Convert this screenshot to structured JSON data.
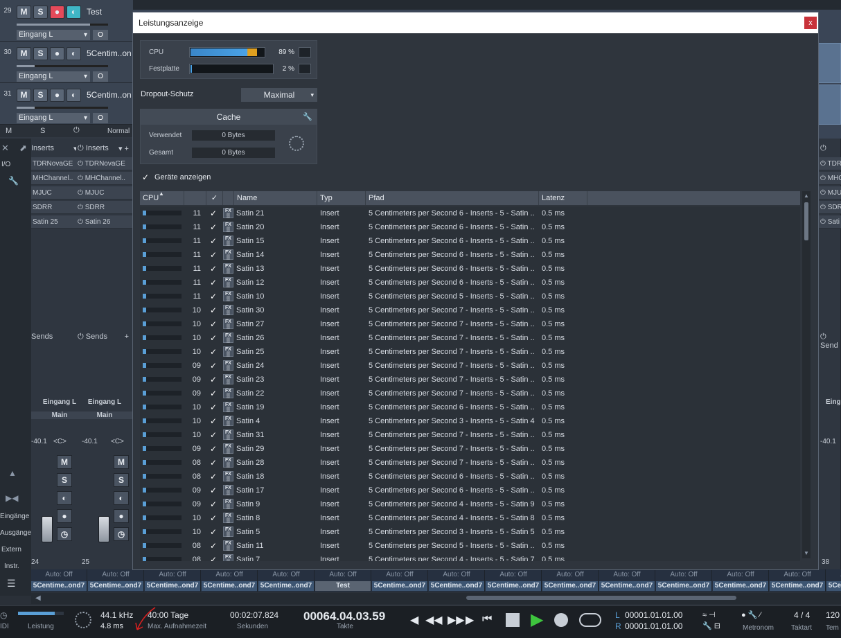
{
  "tracks": [
    {
      "num": "29",
      "m": "M",
      "s": "S",
      "name": "Test",
      "input": "Eingang L",
      "rec_active": true
    },
    {
      "num": "30",
      "m": "M",
      "s": "S",
      "name": "5Centim..on",
      "input": "Eingang L",
      "rec_active": false
    },
    {
      "num": "31",
      "m": "M",
      "s": "S",
      "name": "5Centim..on",
      "input": "Eingang L",
      "rec_active": false
    }
  ],
  "track_footer": {
    "m": "M",
    "s": "S",
    "mode": "Normal"
  },
  "mixer": {
    "left_labels": [
      "I/O",
      "Eingänge",
      "Ausgänge",
      "Extern",
      "Instr."
    ],
    "inserts_label": "Inserts",
    "sends_label": "Sends",
    "ch1_inserts": [
      "TDRNovaGE",
      "MHChannel..",
      "MJUC",
      "SDRR",
      "Satin 25"
    ],
    "ch2_inserts": [
      "TDRNovaGE",
      "MHChannel..",
      "MJUC",
      "SDRR",
      "Satin 26"
    ],
    "input_label": "Eingang L",
    "output_label": "Main",
    "ch1_vol": "-40.1",
    "ch2_vol": "-40.1",
    "ch_pan": "<C>",
    "ch1_num": "24",
    "ch2_num": "25",
    "right_num": "38",
    "right_vol": "-40.1",
    "right_insert_partial": [
      "TDR",
      "MHC",
      "MJU",
      "SDR",
      "Sati"
    ],
    "right_sends": "Send",
    "right_input": "Eing",
    "scale": [
      "10",
      "6",
      "0",
      "-6",
      "-12",
      "-24",
      "-36",
      "-48",
      "-72"
    ]
  },
  "channel_strip": [
    {
      "auto": "Auto: Off",
      "name": "5Centime..ond7"
    },
    {
      "auto": "Auto: Off",
      "name": "5Centime..ond7"
    },
    {
      "auto": "Auto: Off",
      "name": "5Centime..ond7"
    },
    {
      "auto": "Auto: Off",
      "name": "5Centime..ond7"
    },
    {
      "auto": "Auto: Off",
      "name": "5Centime..ond7"
    },
    {
      "auto": "Auto: Off",
      "name": "Test"
    },
    {
      "auto": "Auto: Off",
      "name": "5Centime..ond7"
    },
    {
      "auto": "Auto: Off",
      "name": "5Centime..ond7"
    },
    {
      "auto": "Auto: Off",
      "name": "5Centime..ond7"
    },
    {
      "auto": "Auto: Off",
      "name": "5Centime..ond7"
    },
    {
      "auto": "Auto: Off",
      "name": "5Centime..ond7"
    },
    {
      "auto": "Auto: Off",
      "name": "5Centime..ond7"
    },
    {
      "auto": "Auto: Off",
      "name": "5Centime..ond7"
    },
    {
      "auto": "Auto: Off",
      "name": "5Centime..ond7"
    },
    {
      "auto": "Auto: Off",
      "name": "5Centime..ond7"
    }
  ],
  "transport": {
    "midi": "IDI",
    "performance_label": "Leistung",
    "sample_rate": "44.1 kHz",
    "latency": "4.8 ms",
    "rec_time": "40:00 Tage",
    "rec_time_label": "Max. Aufnahmezeit",
    "seconds": "00:02:07.824",
    "seconds_label": "Sekunden",
    "bars": "00064.04.03.59",
    "bars_label": "Takte",
    "loop_l": "00001.01.01.00",
    "loop_r": "00001.01.01.00",
    "l": "L",
    "r": "R",
    "metronome": "Metronom",
    "timesig": "4 / 4",
    "timesig_label": "Taktart",
    "tempo": "120",
    "tempo_label": "Tem"
  },
  "dialog": {
    "title": "Leistungsanzeige",
    "close": "x",
    "cpu_label": "CPU",
    "cpu_value": "89 %",
    "cpu_level": 0.89,
    "disk_label": "Festplatte",
    "disk_value": "2 %",
    "disk_level": 0.02,
    "dropout_label": "Dropout-Schutz",
    "dropout_value": "Maximal",
    "cache_title": "Cache",
    "cache_used_label": "Verwendet",
    "cache_used_value": "0 Bytes",
    "cache_total_label": "Gesamt",
    "cache_total_value": "0 Bytes",
    "show_devices_label": "Geräte anzeigen",
    "columns": {
      "cpu": "CPU",
      "name": "Name",
      "type": "Typ",
      "path": "Pfad",
      "latency": "Latenz"
    },
    "rows": [
      {
        "n": "11",
        "name": "Satin 21",
        "type": "Insert",
        "path": "5 Centimeters per Second 6 - Inserts - 5 - Satin ..",
        "lat": "0.5 ms"
      },
      {
        "n": "11",
        "name": "Satin 20",
        "type": "Insert",
        "path": "5 Centimeters per Second 6 - Inserts - 5 - Satin ..",
        "lat": "0.5 ms"
      },
      {
        "n": "11",
        "name": "Satin 15",
        "type": "Insert",
        "path": "5 Centimeters per Second 6 - Inserts - 5 - Satin ..",
        "lat": "0.5 ms"
      },
      {
        "n": "11",
        "name": "Satin 14",
        "type": "Insert",
        "path": "5 Centimeters per Second 6 - Inserts - 5 - Satin ..",
        "lat": "0.5 ms"
      },
      {
        "n": "11",
        "name": "Satin 13",
        "type": "Insert",
        "path": "5 Centimeters per Second 6 - Inserts - 5 - Satin ..",
        "lat": "0.5 ms"
      },
      {
        "n": "11",
        "name": "Satin 12",
        "type": "Insert",
        "path": "5 Centimeters per Second 6 - Inserts - 5 - Satin ..",
        "lat": "0.5 ms"
      },
      {
        "n": "11",
        "name": "Satin 10",
        "type": "Insert",
        "path": "5 Centimeters per Second 5 - Inserts - 5 - Satin ..",
        "lat": "0.5 ms"
      },
      {
        "n": "10",
        "name": "Satin 30",
        "type": "Insert",
        "path": "5 Centimeters per Second 7 - Inserts - 5 - Satin ..",
        "lat": "0.5 ms"
      },
      {
        "n": "10",
        "name": "Satin 27",
        "type": "Insert",
        "path": "5 Centimeters per Second 7 - Inserts - 5 - Satin ..",
        "lat": "0.5 ms"
      },
      {
        "n": "10",
        "name": "Satin 26",
        "type": "Insert",
        "path": "5 Centimeters per Second 7 - Inserts - 5 - Satin ..",
        "lat": "0.5 ms"
      },
      {
        "n": "10",
        "name": "Satin 25",
        "type": "Insert",
        "path": "5 Centimeters per Second 7 - Inserts - 5 - Satin ..",
        "lat": "0.5 ms"
      },
      {
        "n": "09",
        "name": "Satin 24",
        "type": "Insert",
        "path": "5 Centimeters per Second 7 - Inserts - 5 - Satin ..",
        "lat": "0.5 ms"
      },
      {
        "n": "09",
        "name": "Satin 23",
        "type": "Insert",
        "path": "5 Centimeters per Second 7 - Inserts - 5 - Satin ..",
        "lat": "0.5 ms"
      },
      {
        "n": "09",
        "name": "Satin 22",
        "type": "Insert",
        "path": "5 Centimeters per Second 7 - Inserts - 5 - Satin ..",
        "lat": "0.5 ms"
      },
      {
        "n": "10",
        "name": "Satin 19",
        "type": "Insert",
        "path": "5 Centimeters per Second 6 - Inserts - 5 - Satin ..",
        "lat": "0.5 ms"
      },
      {
        "n": "10",
        "name": "Satin 4",
        "type": "Insert",
        "path": "5 Centimeters per Second 3 - Inserts - 5 - Satin 4",
        "lat": "0.5 ms"
      },
      {
        "n": "10",
        "name": "Satin 31",
        "type": "Insert",
        "path": "5 Centimeters per Second 7 - Inserts - 5 - Satin ..",
        "lat": "0.5 ms"
      },
      {
        "n": "09",
        "name": "Satin 29",
        "type": "Insert",
        "path": "5 Centimeters per Second 7 - Inserts - 5 - Satin ..",
        "lat": "0.5 ms"
      },
      {
        "n": "08",
        "name": "Satin 28",
        "type": "Insert",
        "path": "5 Centimeters per Second 7 - Inserts - 5 - Satin ..",
        "lat": "0.5 ms"
      },
      {
        "n": "08",
        "name": "Satin 18",
        "type": "Insert",
        "path": "5 Centimeters per Second 6 - Inserts - 5 - Satin ..",
        "lat": "0.5 ms"
      },
      {
        "n": "09",
        "name": "Satin 17",
        "type": "Insert",
        "path": "5 Centimeters per Second 6 - Inserts - 5 - Satin ..",
        "lat": "0.5 ms"
      },
      {
        "n": "09",
        "name": "Satin 9",
        "type": "Insert",
        "path": "5 Centimeters per Second 4 - Inserts - 5 - Satin 9",
        "lat": "0.5 ms"
      },
      {
        "n": "10",
        "name": "Satin 8",
        "type": "Insert",
        "path": "5 Centimeters per Second 4 - Inserts - 5 - Satin 8",
        "lat": "0.5 ms"
      },
      {
        "n": "10",
        "name": "Satin 5",
        "type": "Insert",
        "path": "5 Centimeters per Second 3 - Inserts - 5 - Satin 5",
        "lat": "0.5 ms"
      },
      {
        "n": "08",
        "name": "Satin 11",
        "type": "Insert",
        "path": "5 Centimeters per Second 5 - Inserts - 5 - Satin ..",
        "lat": "0.5 ms"
      },
      {
        "n": "08",
        "name": "Satin 7",
        "type": "Insert",
        "path": "5 Centimeters per Second 4 - Inserts - 5 - Satin 7",
        "lat": "0.5 ms"
      }
    ]
  }
}
